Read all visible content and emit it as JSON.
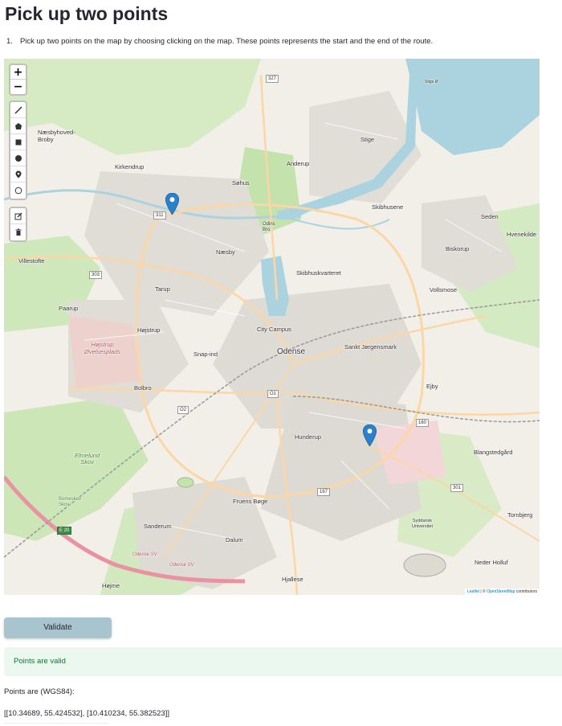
{
  "page": {
    "title": "Pick up two points",
    "instructions": {
      "number": "1.",
      "text": "Pick up two points on the map by choosing clicking on the map. These points represents the start and the end of the route."
    }
  },
  "map": {
    "zoom_in": "+",
    "zoom_out": "−",
    "draw_tools": [
      "polyline-icon",
      "polygon-icon",
      "rectangle-icon",
      "circle-icon",
      "marker-icon",
      "circlemarker-icon"
    ],
    "edit_tools": [
      "edit-icon",
      "delete-icon"
    ],
    "labels": {
      "naesbyhoved": "Næsbyhoved-\nBroby",
      "kirkendrup": "Kirkendrup",
      "sohus": "Søhus",
      "anderup": "Anderup",
      "stige": "Stige",
      "stige_o": "Stige Ø",
      "skibhusene": "Skibhusene",
      "seden": "Seden",
      "hvenekilde": "Hvenekilde",
      "villestofte": "Villestofte",
      "naesby": "Næsby",
      "odins_bro": "Odins\nBro",
      "biskorup": "Biskorup",
      "skibhuskvarteret": "Skibhuskvarteret",
      "tarup": "Tarup",
      "paarup": "Paarup",
      "vollsmose": "Vollsmose",
      "hojstrup": "Højstrup",
      "hojstrup_ovelse": "Højstrup\nØvelsesplads",
      "city_campus": "City Campus",
      "odense": "Odense",
      "sankt_jorgensmark": "Sankt Jørgensmark",
      "snap_ind": "Snap-ind",
      "bolbro": "Bolbro",
      "ejby": "Ejby",
      "hunderup": "Hunderup",
      "blangstedgard": "Blangstedgård",
      "elmelund_skov": "Elmelund\nSkov",
      "fruens_boge": "Fruens Bøge",
      "tornbjerg": "Tornbjerg",
      "sanderum": "Sanderum",
      "dalum": "Dalum",
      "syddansk": "Syddansk\nUniversitet",
      "neder_holluf": "Neder Holluf",
      "hojme": "Højme",
      "hjallese": "Hjallese",
      "odense_sv": "Odense SV",
      "odense_sv2": "Odense SV",
      "boneskov": "Bomeskov\nSkov"
    },
    "road_shields": {
      "r327": "327",
      "r311": "311",
      "r303": "303",
      "r01": "O1",
      "r02": "O2",
      "r160": "160",
      "r167": "167",
      "r301": "301",
      "e20": "E 20"
    },
    "attribution": {
      "leaflet": "Leaflet",
      "separator": " | © ",
      "osm": "OpenStreetMap",
      "contributors": " contributors"
    },
    "markers": [
      "start-point",
      "end-point"
    ],
    "colors": {
      "land": "#f2efe9",
      "water": "#aad3df",
      "park": "#c8e6b0",
      "residential": "#dcd8d3",
      "motorway": "#e892a2",
      "primary": "#fcd6a4",
      "marker": "#2a81cb"
    }
  },
  "controls": {
    "validate_label": "Validate"
  },
  "result": {
    "status": "Points are valid",
    "points_label": "Points are (WGS84):",
    "points_value": "[[10.34689, 55.424532], [10.410234, 55.382523]]"
  }
}
